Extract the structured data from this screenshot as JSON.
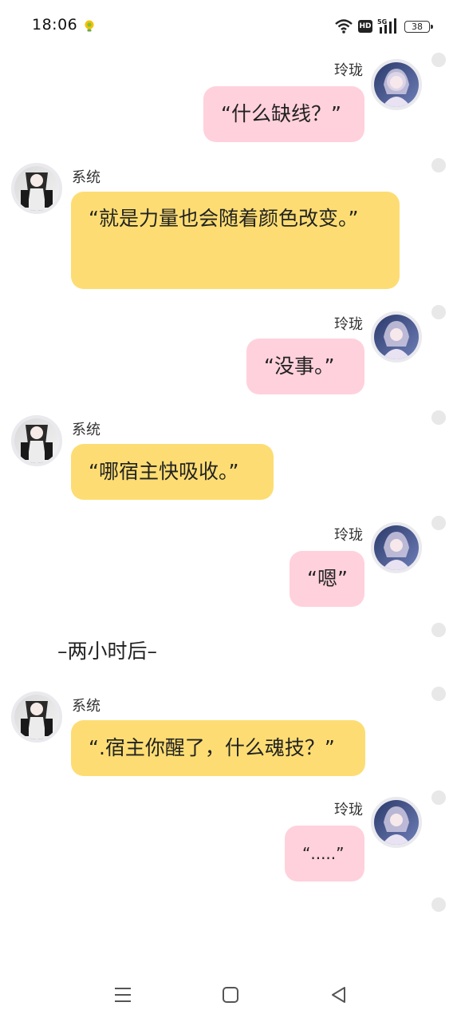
{
  "status_bar": {
    "time": "18:06",
    "network": "5G",
    "hd": "HD",
    "battery": "38"
  },
  "messages": [
    {
      "sender": "玲珑",
      "side": "right",
      "text": "“什么缺线？”"
    },
    {
      "sender": "系统",
      "side": "left",
      "text": "“就是力量也会随着颜色改变。”"
    },
    {
      "sender": "玲珑",
      "side": "right",
      "text": "“没事。”"
    },
    {
      "sender": "系统",
      "side": "left",
      "text": "“哪宿主快吸收。”"
    },
    {
      "sender": "玲珑",
      "side": "right",
      "text": "“嗯”"
    },
    {
      "type": "narration",
      "text": "–两小时后–"
    },
    {
      "sender": "系统",
      "side": "left",
      "text": "“.宿主你醒了，什么魂技？”"
    },
    {
      "sender": "玲珑",
      "side": "right",
      "text": "“.....”"
    }
  ],
  "colors": {
    "user_bubble": "#ffd1dc",
    "system_bubble": "#fddd73",
    "avatar_border": "#e9e9ee"
  },
  "nav": {
    "icons": [
      "menu-icon",
      "home-icon",
      "back-icon"
    ]
  }
}
